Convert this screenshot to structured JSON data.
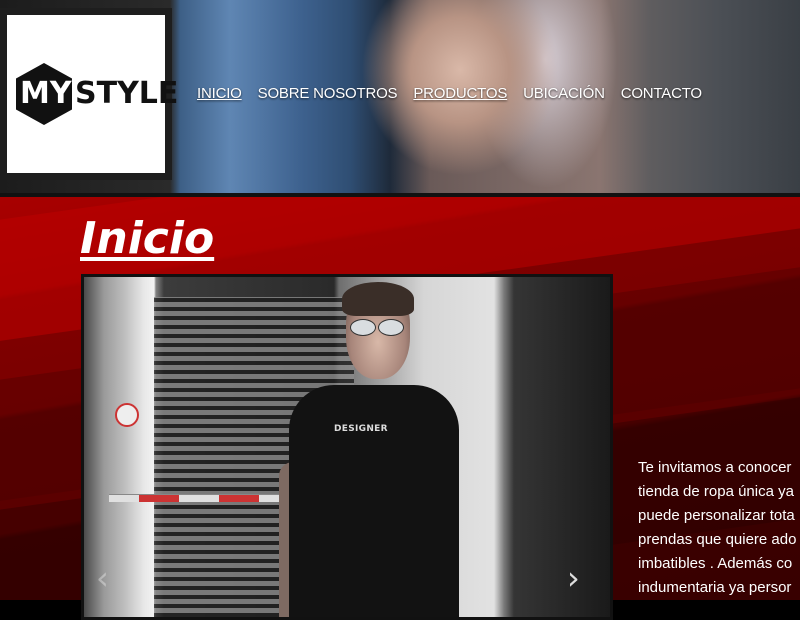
{
  "brand": {
    "logo_my": "MY",
    "logo_style": "STYLE"
  },
  "nav": {
    "items": [
      {
        "label": "INICIO"
      },
      {
        "label": "SOBRE NOSOTROS"
      },
      {
        "label": "PRODUCTOS"
      },
      {
        "label": "UBICACIÓN"
      },
      {
        "label": "CONTACTO"
      }
    ]
  },
  "main": {
    "title": "Inicio",
    "hero": {
      "shirt_text": "DESIGNER",
      "prev_icon": "chevron-left-icon",
      "next_icon": "chevron-right-icon"
    },
    "intro_lines": [
      "Te invitamos a conocer",
      "tienda de ropa única ya",
      "puede personalizar tota",
      "prendas que quiere ado",
      "imbatibles . Además co",
      "indumentaria ya persor"
    ]
  },
  "colors": {
    "accent_red": "#9a0000",
    "dark_red": "#3e0000",
    "text": "#ffffff"
  }
}
